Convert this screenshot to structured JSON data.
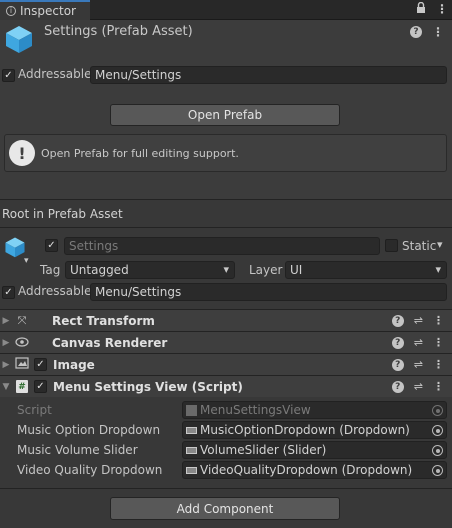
{
  "tab": {
    "title": "Inspector"
  },
  "asset": {
    "title": "Settings (Prefab Asset)"
  },
  "addressable": {
    "label": "Addressable",
    "checked": true,
    "path": "Menu/Settings"
  },
  "open_prefab": {
    "label": "Open Prefab"
  },
  "help": {
    "text": "Open Prefab for full editing support."
  },
  "root_label": "Root in Prefab Asset",
  "gameobject": {
    "name": "Settings",
    "active": true,
    "static_label": "Static",
    "tag_label": "Tag",
    "tag_value": "Untagged",
    "layer_label": "Layer",
    "layer_value": "UI",
    "addressable_label": "Addressable",
    "addressable_path": "Menu/Settings"
  },
  "components": [
    {
      "name": "Rect Transform",
      "icon": "rect-transform-icon"
    },
    {
      "name": "Canvas Renderer",
      "icon": "eye-icon"
    },
    {
      "name": "Image",
      "icon": "image-icon"
    },
    {
      "name": "Menu Settings View (Script)",
      "icon": "script-icon"
    }
  ],
  "script_props": [
    {
      "label": "Script",
      "value": "MenuSettingsView"
    },
    {
      "label": "Music Option Dropdown",
      "value": "MusicOptionDropdown (Dropdown)"
    },
    {
      "label": "Music Volume Slider",
      "value": "VolumeSlider (Slider)"
    },
    {
      "label": "Video Quality Dropdown",
      "value": "VideoQualityDropdown (Dropdown)"
    }
  ],
  "add_component": {
    "label": "Add Component"
  },
  "colors": {
    "accent": "#3a79bb",
    "background": "#383838",
    "header": "#3c3c3c"
  }
}
